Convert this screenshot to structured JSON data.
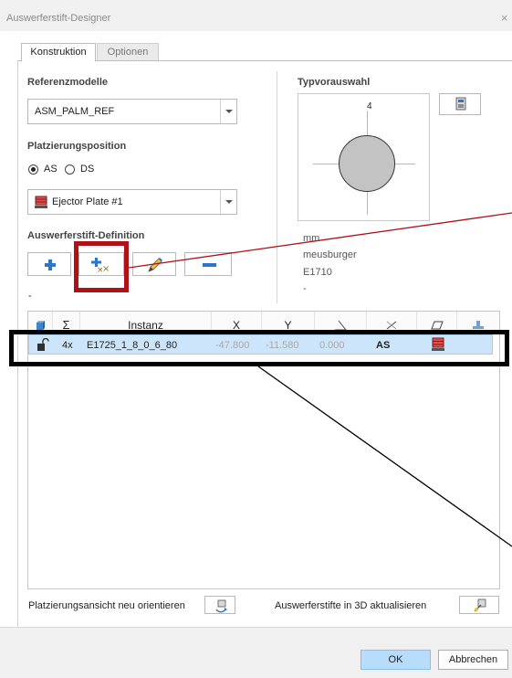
{
  "window": {
    "title": "Auswerferstift-Designer"
  },
  "tabs": [
    {
      "label": "Konstruktion",
      "active": true
    },
    {
      "label": "Optionen",
      "active": false
    }
  ],
  "referenzmodelle": {
    "label": "Referenzmodelle",
    "value": "ASM_PALM_REF"
  },
  "platzierung": {
    "label": "Platzierungsposition",
    "options": [
      {
        "label": "AS",
        "selected": true
      },
      {
        "label": "DS",
        "selected": false
      }
    ],
    "plate": "Ejector Plate #1"
  },
  "definition": {
    "label": "Auswerferstift-Definition",
    "status": "-",
    "buttons": [
      "add-pin",
      "add-pin-pattern",
      "edit-pin",
      "remove-pin"
    ]
  },
  "typvorauswahl": {
    "label": "Typvorauswahl",
    "preview_number": "4",
    "unit": "mm",
    "manufacturer": "meusburger",
    "type": "E1710",
    "extra": "-"
  },
  "table": {
    "columns": [
      "",
      "Σ",
      "Instanz",
      "X",
      "Y",
      "",
      "",
      "",
      ""
    ],
    "rows": [
      {
        "count": "4x",
        "instance": "E1725_1_8_0_6_80",
        "x": "-47.800",
        "y": "-11.580",
        "angle": "0.000",
        "side": "AS"
      }
    ]
  },
  "bottom": {
    "reorient_label": "Platzierungsansicht neu orientieren",
    "update_label": "Auswerferstifte in 3D aktualisieren"
  },
  "footer": {
    "ok": "OK",
    "cancel": "Abbrechen"
  },
  "colors": {
    "annotation_red": "#b01116",
    "annotation_black": "#000000",
    "selection": "#cde5fb",
    "accent": "#2b76c8"
  }
}
